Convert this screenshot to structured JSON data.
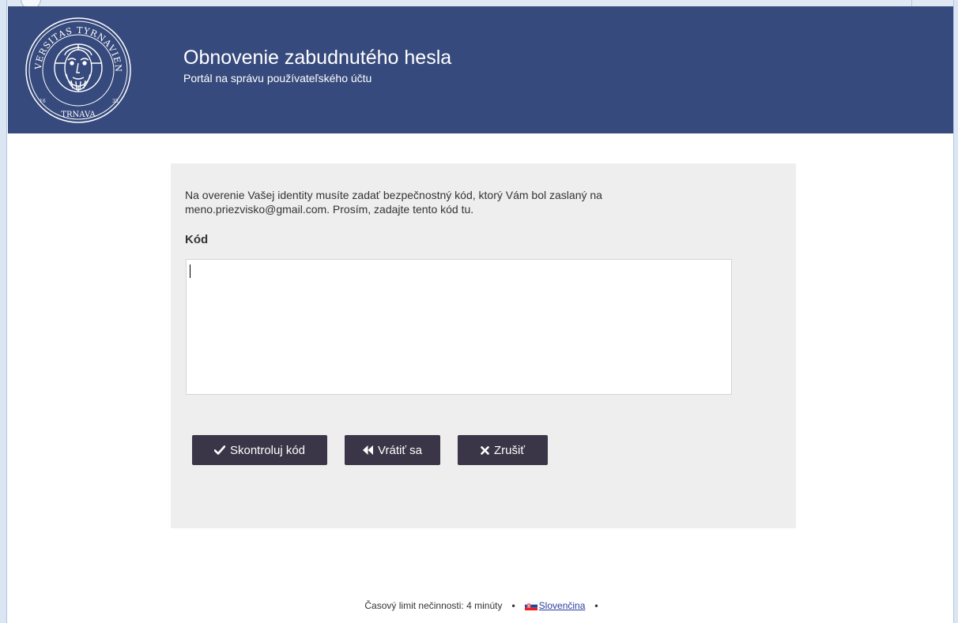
{
  "header": {
    "title": "Obnovenie zabudnutého hesla",
    "subtitle": "Portál na správu používateľského účtu",
    "logo_text_top": "UNIVERSITAS TYRNAVIENSIS",
    "logo_text_bottom": "TRNAVA",
    "logo_year_left": "16",
    "logo_year_right": "35",
    "bg_color": "#374a7d"
  },
  "form": {
    "instructions_line1": "Na overenie Vašej identity musíte zadať bezpečnostný kód, ktorý Vám bol zaslaný na",
    "instructions_line2": "meno.priezvisko@gmail.com. Prosím, zadajte tento kód tu.",
    "code_label": "Kód",
    "code_value": ""
  },
  "buttons": {
    "check_label": "Skontroluj kód",
    "check_icon": "check-icon",
    "back_label": "Vrátiť sa",
    "back_icon": "fast-backward-icon",
    "cancel_label": "Zrušiť",
    "cancel_icon": "close-icon",
    "color": "#3b3647"
  },
  "footer": {
    "timeout_text": "Časový limit nečinnosti: 4 minúty",
    "separator": "•",
    "language_label": "Slovenčina",
    "language_flag": "slovak-flag-icon"
  }
}
